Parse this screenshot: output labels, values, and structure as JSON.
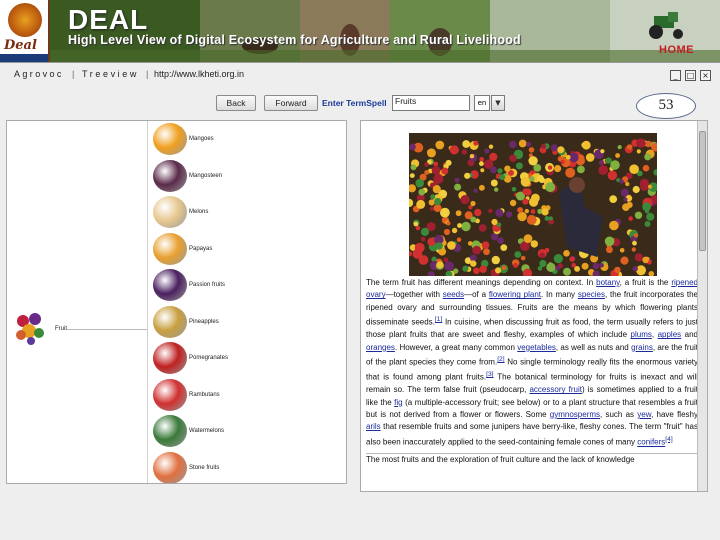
{
  "banner": {
    "title": "DEAL",
    "subtitle": "High Level View of Digital Ecosystem for Agriculture  and Rural Livelihood",
    "home": "HOME",
    "logo_text": "Deal"
  },
  "tabs": {
    "agrovoc": "Agrovoc",
    "treeview": "Treeview",
    "url": "http://www.lkheti.org.in"
  },
  "toolbar": {
    "back": "Back",
    "forward": "Forward",
    "term_label": "Enter TermSpell",
    "term_value": "Fruits",
    "lang": "en"
  },
  "slide_number": "53",
  "tree": {
    "root_label": "Fruit",
    "items": [
      {
        "label": "Mangoes",
        "color": "#f0a020"
      },
      {
        "label": "Mangosteen",
        "color": "#5a2a4a"
      },
      {
        "label": "Melons",
        "color": "#e8c890"
      },
      {
        "label": "Papayas",
        "color": "#e8a030"
      },
      {
        "label": "Passion fruits",
        "color": "#4a2060"
      },
      {
        "label": "Pineapples",
        "color": "#c8a040"
      },
      {
        "label": "Pomegranates",
        "color": "#c02020"
      },
      {
        "label": "Rambutans",
        "color": "#d03030"
      },
      {
        "label": "Watermelons",
        "color": "#3a7a3a"
      },
      {
        "label": "Stone fruits",
        "color": "#e07040"
      }
    ]
  },
  "description": {
    "p1": "The term fruit has different meanings depending on context. In ",
    "link_botany": "botany",
    "p2": ", a fruit is the ",
    "link_ripened": "ripened ovary",
    "p3": "—together with ",
    "link_seeds": "seeds",
    "p4": "—of a ",
    "link_flowering": "flowering plant",
    "p5": ". In many ",
    "link_species": "species",
    "p6": ", the fruit incorporates the ripened ovary and surrounding tissues. Fruits are the means by which flowering plants disseminate seeds.",
    "ref1": "[1]",
    "p7": " In cuisine, when discussing fruit as food, the term usually refers to just those plant fruits that are sweet and fleshy, examples of which include ",
    "link_plums": "plums",
    "p8": ", ",
    "link_apples": "apples",
    "p9": " and ",
    "link_oranges": "oranges",
    "p10": ". However, a great many common ",
    "link_vegetables": "vegetables",
    "p11": ", as well as nuts and ",
    "link_grains": "grains",
    "p12": ", are the fruit of the plant species they come from.",
    "ref2": "[2]",
    "p13": " No single terminology really fits the enormous variety that is found among plant fruits.",
    "ref3": "[3]",
    "p14": " The botanical terminology for fruits is inexact and will remain so. The term false fruit (pseudocarp, ",
    "link_accessory": "accessory fruit",
    "p15": ") is sometimes applied to a fruit like the ",
    "link_fig": "fig",
    "p16": " (a multiple-accessory fruit; see below) or to a plant structure that resembles a fruit but is not derived from a flower or flowers. Some ",
    "link_gymnosperms": "gymnosperms",
    "p17": ", such as ",
    "link_yew": "yew",
    "p18": ", have fleshy ",
    "link_arils": "arils",
    "p19": " that resemble fruits and some junipers have berry-like, fleshy cones. The term \"fruit\" has also been inaccurately applied to the seed-containing female cones of many ",
    "link_conifers": "conifers",
    "ref4": "[4]",
    "p20": "The most fruits and the exploration of fruit culture and the lack of knowledge"
  },
  "colors": {
    "link": "#1a2a9a",
    "accent_red": "#c02020"
  }
}
